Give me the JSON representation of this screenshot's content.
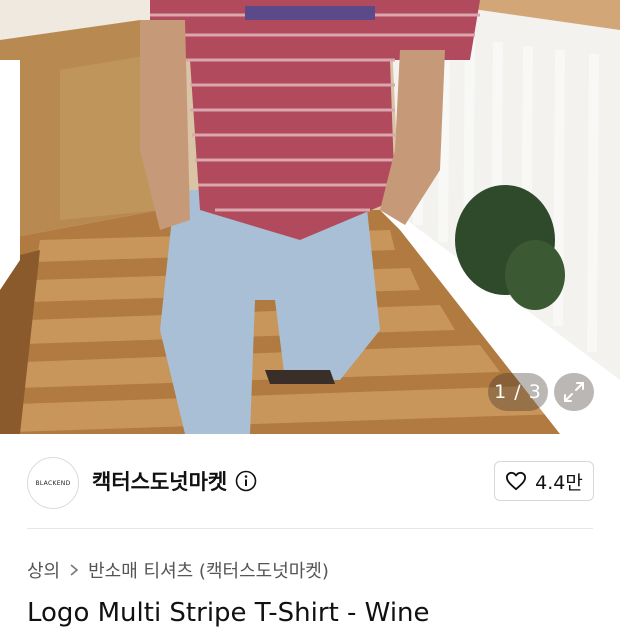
{
  "gallery": {
    "counter": "1 / 3",
    "expand_icon": "expand-arrows-icon"
  },
  "shop": {
    "logo_text": "BLACKEND",
    "name": "캑터스도넛마켓",
    "info_icon": "info-icon",
    "like_icon": "heart-outline-icon",
    "likes": "4.4만"
  },
  "breadcrumb": {
    "category": "상의",
    "separator_icon": "chevron-right-icon",
    "subcategory": "반소매 티셔츠 (캑터스도넛마켓)"
  },
  "product": {
    "title": "Logo Multi Stripe T-Shirt - Wine"
  }
}
